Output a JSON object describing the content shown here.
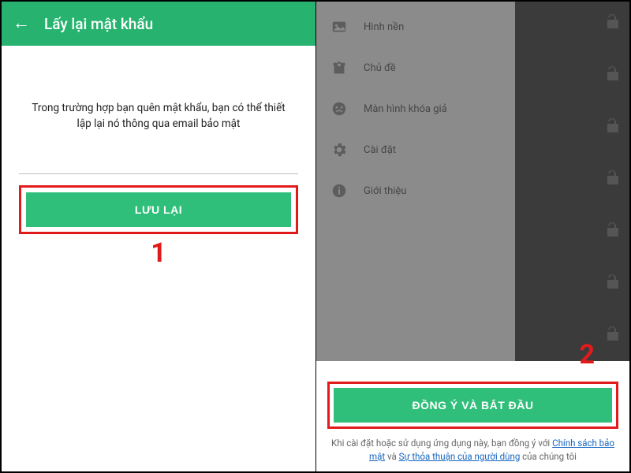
{
  "left": {
    "header_title": "Lấy lại mật khẩu",
    "description": "Trong trường hợp bạn quên mật khẩu, bạn có thể thiết lập lại nó thông qua email bảo mật",
    "save_button": "LƯU LẠI",
    "step_number": "1"
  },
  "right": {
    "menu": [
      {
        "icon": "wallpaper-icon",
        "label": "Hình nền"
      },
      {
        "icon": "theme-icon",
        "label": "Chủ đề"
      },
      {
        "icon": "fakelock-icon",
        "label": "Màn hình khóa giả"
      },
      {
        "icon": "settings-icon",
        "label": "Cài đặt"
      },
      {
        "icon": "about-icon",
        "label": "Giới thiệu"
      }
    ],
    "agree_button": "ĐỒNG Ý VÀ BẮT ĐẦU",
    "agree_prefix": "Khi cài đặt hoặc sử dụng ứng dụng này, bạn đồng ý với ",
    "link_policy": "Chính sách bảo mật",
    "agree_mid": " và ",
    "link_terms": "Sự thỏa thuận của người dùng",
    "agree_suffix": " của chúng tôi",
    "step_number": "2"
  }
}
